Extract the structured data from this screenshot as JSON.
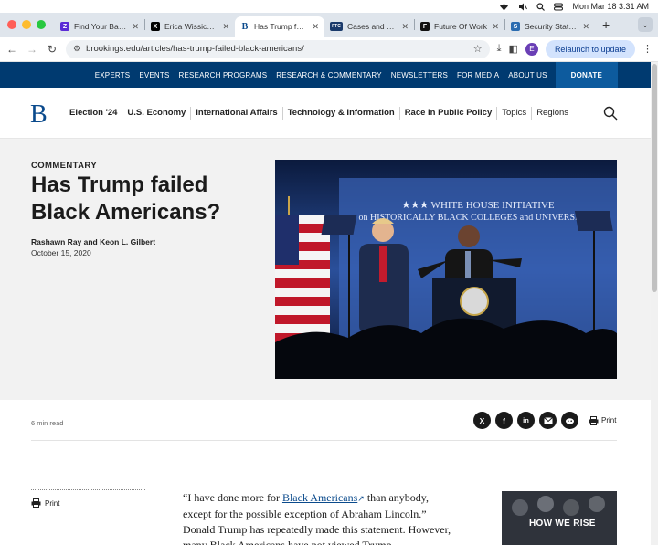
{
  "menubar": {
    "clock": "Mon Mar 18  3:31 AM"
  },
  "tabs": [
    {
      "title": "Find Your Bank |",
      "favicon": "Z",
      "color": "#5b2bd6",
      "active": false
    },
    {
      "title": "Erica Wissick (@",
      "favicon": "X",
      "color": "#000000",
      "active": false
    },
    {
      "title": "Has Trump failed",
      "favicon": "B",
      "color": "#ffffff",
      "active": true
    },
    {
      "title": "Cases and Proce",
      "favicon": "FTC",
      "color": "#1a3a6b",
      "active": false
    },
    {
      "title": "Future Of Work",
      "favicon": "F",
      "color": "#111111",
      "active": false
    },
    {
      "title": "Security State B",
      "favicon": "S",
      "color": "#2b6cb0",
      "active": false
    }
  ],
  "toolbar": {
    "url": "brookings.edu/articles/has-trump-failed-black-americans/",
    "relaunch_label": "Relaunch to update",
    "profile_initial": "E"
  },
  "topnav": {
    "items": [
      "EXPERTS",
      "EVENTS",
      "RESEARCH PROGRAMS",
      "RESEARCH & COMMENTARY",
      "NEWSLETTERS",
      "FOR MEDIA",
      "ABOUT US"
    ],
    "donate": "DONATE"
  },
  "mainnav": {
    "logo": "B",
    "items": [
      "Election '24",
      "U.S. Economy",
      "International Affairs",
      "Technology & Information",
      "Race in Public Policy"
    ],
    "light_items": [
      "Topics",
      "Regions"
    ]
  },
  "article": {
    "kicker": "COMMENTARY",
    "title": "Has Trump failed Black Americans?",
    "authors": "Rashawn Ray and Keon L. Gilbert",
    "date": "October 15, 2020",
    "read_time": "6 min read",
    "print_label": "Print",
    "body_1": "“I have done more for ",
    "body_link": "Black Americans",
    "body_2": " than anybody, except for the possible exception of Abraham Lincoln.” Donald Trump has repeatedly made this statement. However, many Black Americans have not viewed Trump",
    "photo_banner": "WHITE HOUSE INITIATIVE on HISTORICALLY BLACK COLLEGES and UNIVERSITIES",
    "promo_title": "HOW WE RISE"
  },
  "share": {
    "x": "X",
    "facebook": "f",
    "linkedin": "in"
  },
  "colors": {
    "brand_navy": "#003a70",
    "donate": "#0d5b9e",
    "link": "#0a4a8c"
  }
}
